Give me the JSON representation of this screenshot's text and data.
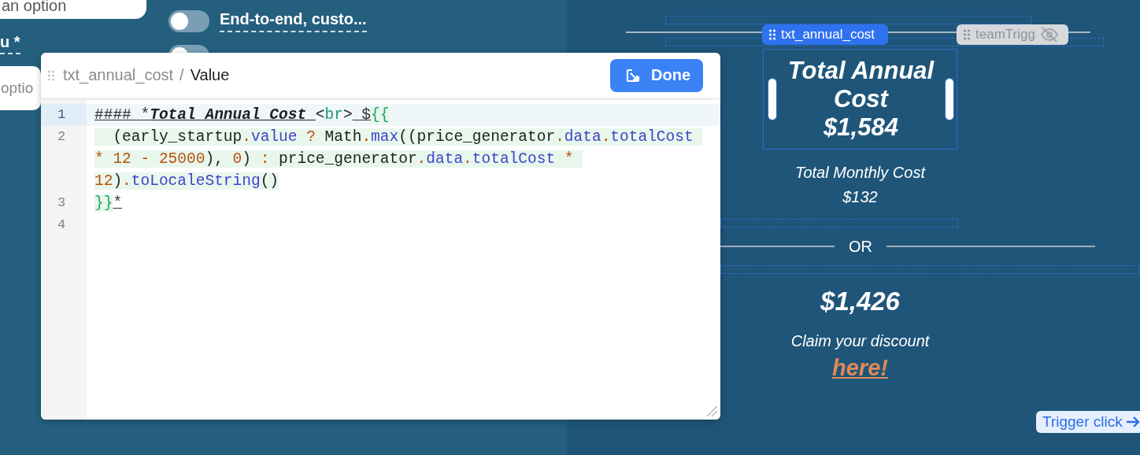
{
  "background_form": {
    "field_top": {
      "value": "an option"
    },
    "label": "u *",
    "field_bottom": {
      "value": "optio"
    },
    "toggles": [
      {
        "label": "End-to-end, custo...",
        "on": false
      },
      {
        "on": false
      }
    ]
  },
  "dialog": {
    "breadcrumb": "txt_annual_cost",
    "separator": "/",
    "title": "Value",
    "done_button": "Done",
    "lines": [
      {
        "number": "1",
        "active": true,
        "tokens": [
          {
            "text": "#### ",
            "kind": "heading"
          },
          {
            "text": "*",
            "kind": "heading"
          },
          {
            "text": "Total Annual Cost ",
            "kind": "emphasis"
          },
          {
            "text": "<",
            "kind": "plain"
          },
          {
            "text": "br",
            "kind": "tag"
          },
          {
            "text": ">",
            "kind": "plain"
          },
          {
            "text": " $",
            "kind": "heading"
          },
          {
            "text": "{{",
            "kind": "brace"
          }
        ]
      },
      {
        "number": "2",
        "active": false,
        "expression": true,
        "tokens": [
          {
            "text": "  (early_startup",
            "kind": "plain"
          },
          {
            "text": ".",
            "kind": "operator"
          },
          {
            "text": "value",
            "kind": "property"
          },
          {
            "text": " ? ",
            "kind": "operator"
          },
          {
            "text": "Math",
            "kind": "plain"
          },
          {
            "text": ".",
            "kind": "operator"
          },
          {
            "text": "max",
            "kind": "property"
          },
          {
            "text": "((price_generator",
            "kind": "plain"
          },
          {
            "text": ".",
            "kind": "operator"
          },
          {
            "text": "data",
            "kind": "property"
          },
          {
            "text": ".",
            "kind": "operator"
          },
          {
            "text": "totalCost",
            "kind": "property"
          },
          {
            "text": " * 12 - 25000",
            "kind": "operator"
          },
          {
            "text": "), ",
            "kind": "plain"
          },
          {
            "text": "0",
            "kind": "operator"
          },
          {
            "text": ") ",
            "kind": "plain"
          },
          {
            "text": ":",
            "kind": "operator"
          },
          {
            "text": " price_generator",
            "kind": "plain"
          },
          {
            "text": ".",
            "kind": "operator"
          },
          {
            "text": "data",
            "kind": "property"
          },
          {
            "text": ".",
            "kind": "operator"
          },
          {
            "text": "totalCost",
            "kind": "property"
          },
          {
            "text": " * 12",
            "kind": "operator"
          },
          {
            "text": ")",
            "kind": "plain"
          },
          {
            "text": ".",
            "kind": "operator"
          },
          {
            "text": "toLocaleString",
            "kind": "property"
          },
          {
            "text": "()",
            "kind": "plain"
          }
        ]
      },
      {
        "number": "3",
        "active": false,
        "tokens": [
          {
            "text": "}}",
            "kind": "brace"
          },
          {
            "text": "*",
            "kind": "heading"
          }
        ]
      },
      {
        "number": "4",
        "active": false
      }
    ]
  },
  "canvas": {
    "selected_label": "txt_annual_cost",
    "hidden_label": "teamTrigg",
    "annual_heading": "Total Annual Cost",
    "annual_amount": "$1,584",
    "monthly_heading": "Total Monthly Cost",
    "monthly_amount": "$132",
    "divider_text": "OR",
    "discount_amount": "$1,426",
    "claim_text": "Claim your discount",
    "claim_link": "here!",
    "trigger_button": "Trigger click"
  }
}
